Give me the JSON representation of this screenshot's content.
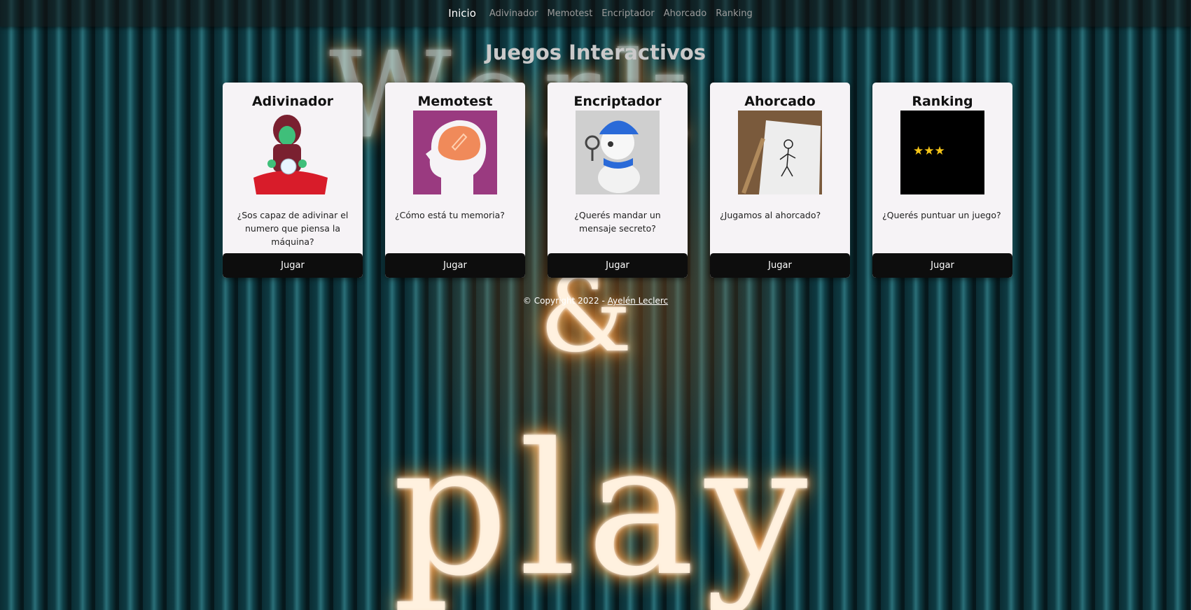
{
  "nav": {
    "brand": "Inicio",
    "links": [
      "Adivinador",
      "Memotest",
      "Encriptador",
      "Ahorcado",
      "Ranking"
    ]
  },
  "page_title": "Juegos Interactivos",
  "cards": [
    {
      "title": "Adivinador",
      "text": "¿Sos capaz de adivinar el numero que piensa la máquina?",
      "button": "Jugar",
      "icon": "fortune-teller-icon"
    },
    {
      "title": "Memotest",
      "text": "¿Cómo está tu memoria?",
      "button": "Jugar",
      "icon": "brain-icon"
    },
    {
      "title": "Encriptador",
      "text": "¿Querés mandar un mensaje secreto?",
      "button": "Jugar",
      "icon": "detective-seal-icon"
    },
    {
      "title": "Ahorcado",
      "text": "¿Jugamos al ahorcado?",
      "button": "Jugar",
      "icon": "hangman-drawing-icon"
    },
    {
      "title": "Ranking",
      "text": "¿Querés puntuar un juego?",
      "button": "Jugar",
      "icon": "stars-icon"
    }
  ],
  "ranking_stars": "★★★",
  "footer": {
    "prefix": "© Copyright 2022 - ",
    "author": "Ayelén Leclerc"
  },
  "background": {
    "neon_top": "Work",
    "neon_amp": "&",
    "neon_play": "play"
  },
  "colors": {
    "navbar_bg": "#141414",
    "card_bg": "#f6f3f6",
    "button_bg": "#0d0d0d",
    "memotest_bg": "#9a3a80",
    "star": "#f5c518"
  }
}
